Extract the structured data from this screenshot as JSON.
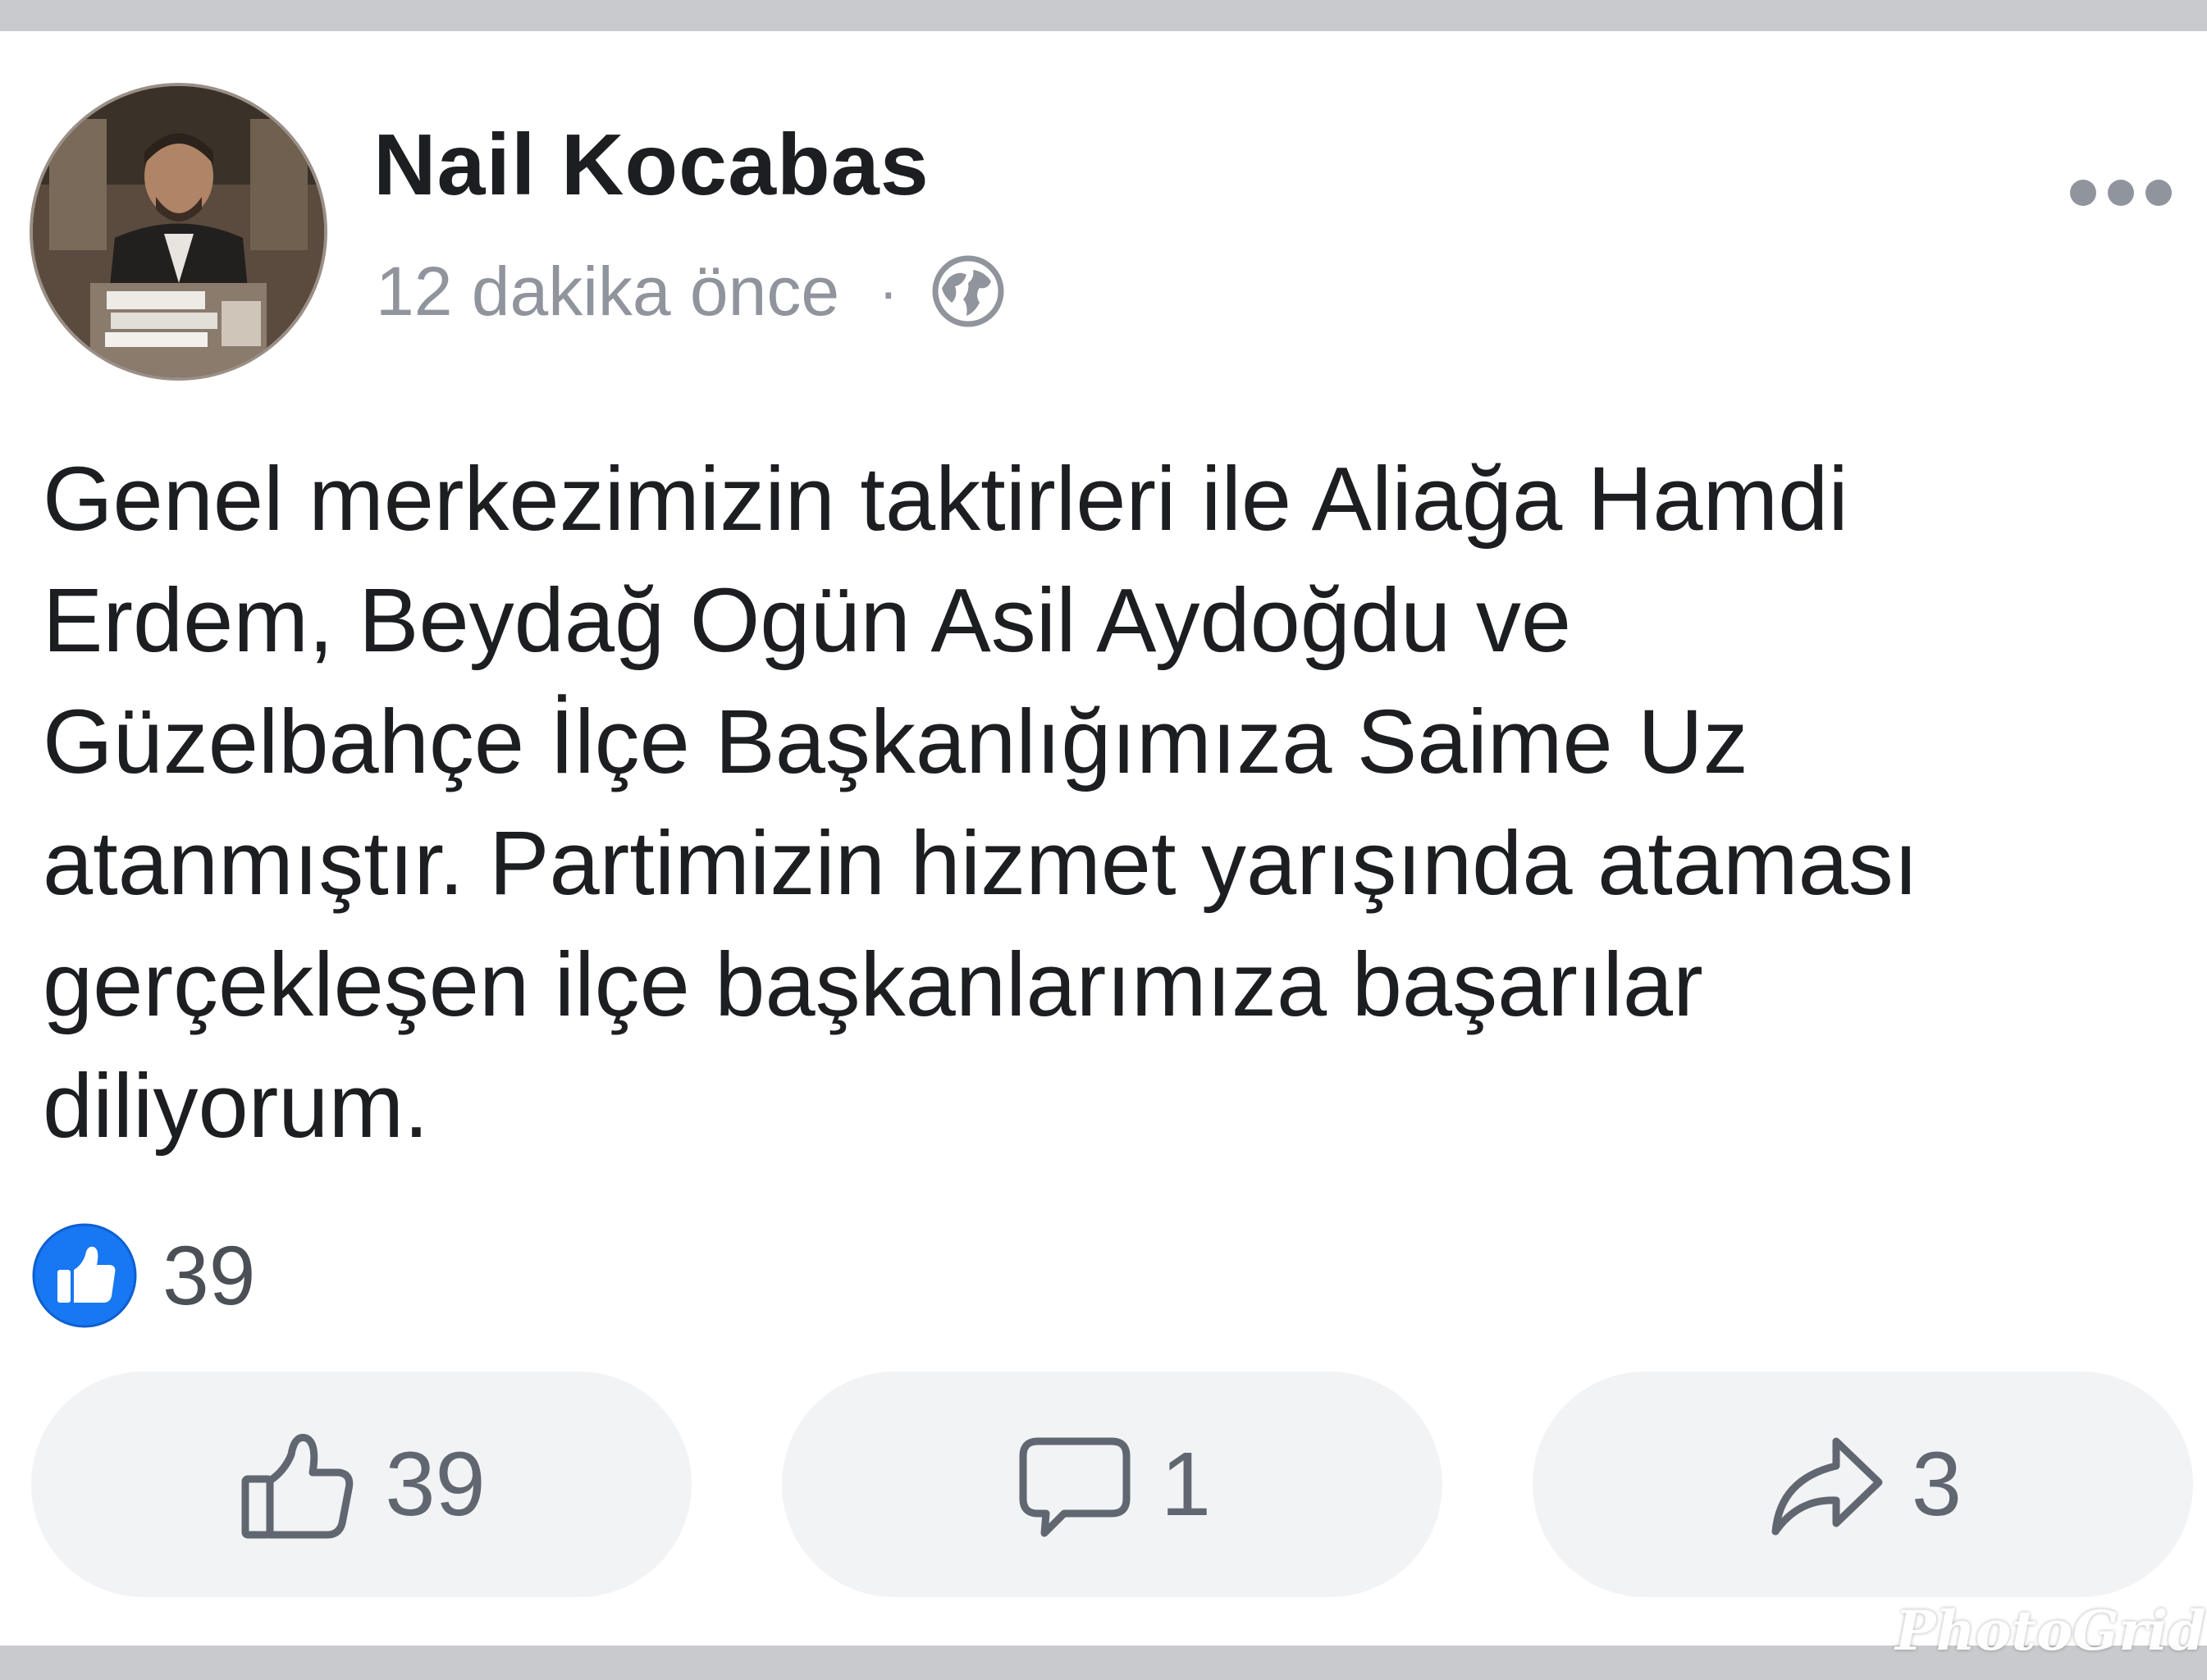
{
  "post": {
    "author_name": "Nail Kocabas",
    "timestamp": "12 dakika önce",
    "meta_separator": "·",
    "privacy_icon": "globe-icon",
    "text": "Genel merkezimizin taktirleri ile Aliağa Hamdi\nErdem, Beydağ Ogün Asil Aydoğdu ve\nGüzelbahçe İlçe Başkanlığımıza Saime Uz\natanmıştır. Partimizin hizmet yarışında ataması\ngerçekleşen ilçe başkanlarımıza başarılar\ndiliyorum."
  },
  "reactions": {
    "icon": "like-reaction-icon",
    "count": "39"
  },
  "actions": {
    "like": {
      "icon": "thumbs-up-icon",
      "count": "39"
    },
    "comment": {
      "icon": "comment-icon",
      "count": "1"
    },
    "share": {
      "icon": "share-icon",
      "count": "3"
    }
  },
  "watermark": "PhotoGrid",
  "colors": {
    "like_blue": "#1877f2",
    "text": "#1c1e21",
    "muted": "#90949c",
    "button_bg": "#f2f3f5",
    "frame": "#c9cacd"
  }
}
